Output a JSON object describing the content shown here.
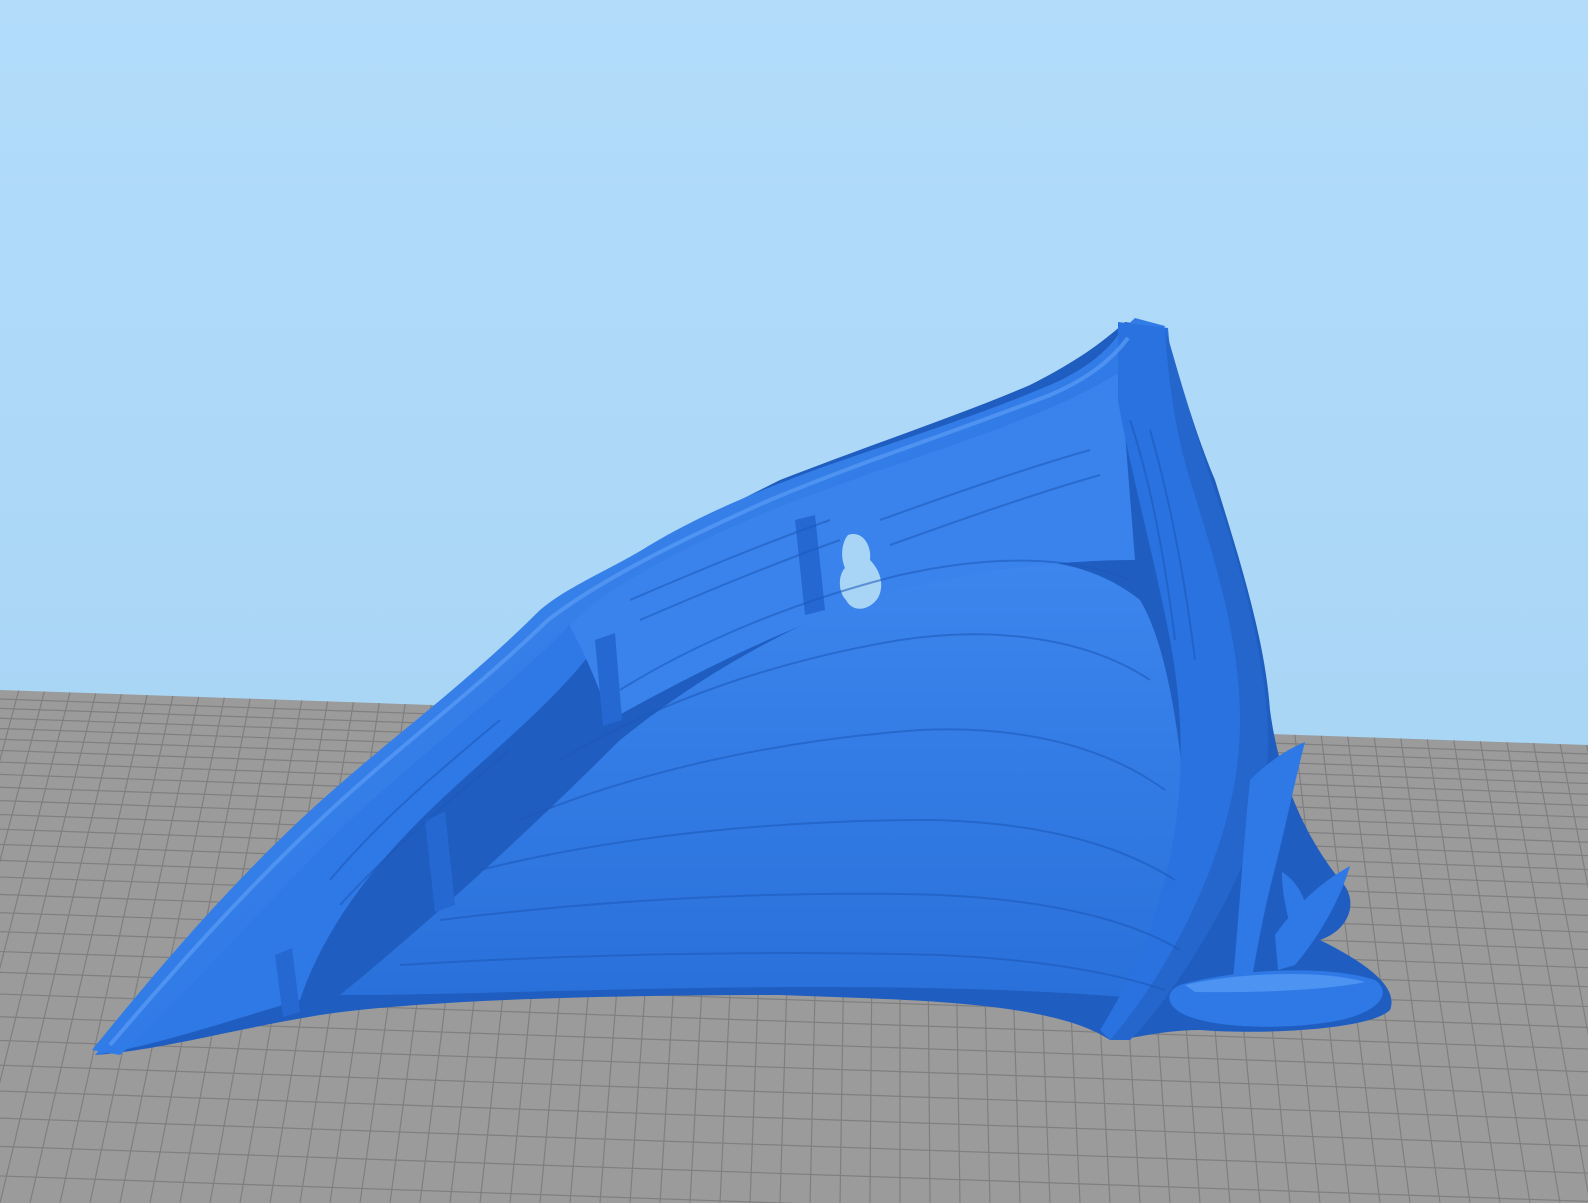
{
  "scene": {
    "view": "slicer-3d-preview",
    "background": {
      "top_color": "#b3dcfb",
      "bottom_color": "#a4d2f3"
    },
    "build_plate": {
      "color": "#9b9b9b",
      "grid_color": "#7f7f7f",
      "icon": "grid-plane"
    },
    "model": {
      "color": "#2f79e6",
      "shadow_color": "#1f5ec0",
      "highlight_color": "#4c93f2",
      "icon": "boat-wreck-model"
    }
  }
}
